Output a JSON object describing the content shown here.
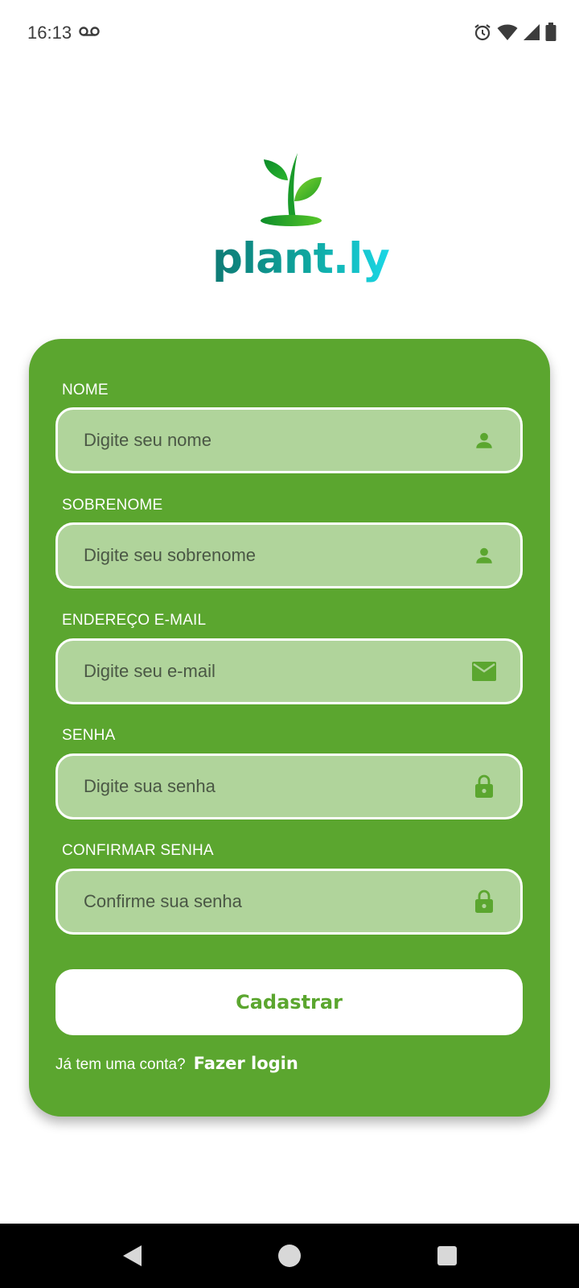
{
  "status_bar": {
    "time": "16:13",
    "icons": [
      "voicemail-icon",
      "alarm-icon",
      "wifi-icon",
      "signal-icon",
      "battery-icon"
    ]
  },
  "logo": {
    "text": "plant.ly",
    "icon": "sprout-logo-icon"
  },
  "form": {
    "fields": [
      {
        "label": "NOME",
        "placeholder": "Digite seu nome",
        "icon": "person-icon"
      },
      {
        "label": "SOBRENOME",
        "placeholder": "Digite seu sobrenome",
        "icon": "person-icon"
      },
      {
        "label": "ENDEREÇO E-MAIL",
        "placeholder": "Digite seu e-mail",
        "icon": "mail-icon"
      },
      {
        "label": "SENHA",
        "placeholder": "Digite sua senha",
        "icon": "lock-icon"
      },
      {
        "label": "CONFIRMAR SENHA",
        "placeholder": "Confirme sua senha",
        "icon": "lock-icon"
      }
    ],
    "submit_label": "Cadastrar",
    "login_prompt": "Já tem uma conta?",
    "login_link": "Fazer login"
  },
  "colors": {
    "card": "#5ba62f",
    "field_bg": "#b0d49b",
    "icon": "#5ba62f",
    "logo_text_start": "#0e7a74",
    "logo_text_end": "#1ad7e6"
  },
  "nav_bar": {
    "buttons": [
      "back-icon",
      "home-icon",
      "recents-icon"
    ]
  }
}
